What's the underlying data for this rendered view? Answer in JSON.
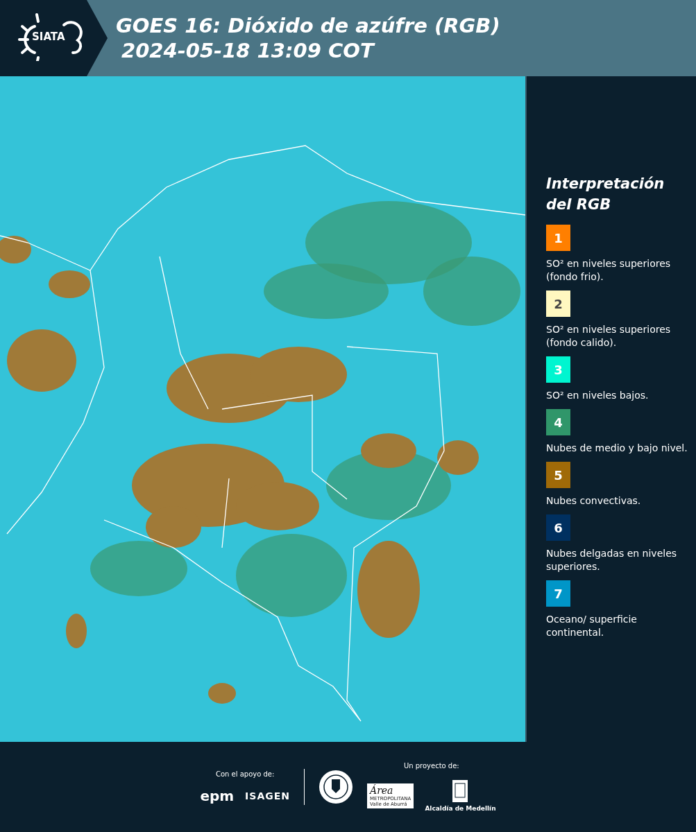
{
  "header": {
    "logo_text": "SIATA",
    "title_lines": [
      "GOES 16: Dióxido de azúfre (RGB)",
      "2024-05-18 13:09 COT"
    ]
  },
  "legend": {
    "title": "Interpretación del RGB",
    "items": [
      {
        "number": "1",
        "color": "#ff7f00",
        "text": "SO² en niveles superiores (fondo frio)."
      },
      {
        "number": "2",
        "color": "#fff8c0",
        "text": "SO² en niveles superiores (fondo calido)."
      },
      {
        "number": "3",
        "color": "#00f5d0",
        "text": "SO² en niveles bajos."
      },
      {
        "number": "4",
        "color": "#30966a",
        "text": "Nubes de medio y bajo nivel."
      },
      {
        "number": "5",
        "color": "#a06a08",
        "text": "Nubes convectivas."
      },
      {
        "number": "6",
        "color": "#003060",
        "text": "Nubes delgadas en niveles superiores."
      },
      {
        "number": "7",
        "color": "#0096c8",
        "text": "Oceano/ superficie continental."
      }
    ]
  },
  "footer": {
    "support_label": "Con el apoyo de:",
    "support_logos": [
      "epm",
      "ISAGEN"
    ],
    "project_label": "Un proyecto de:",
    "area_logo": {
      "name": "Área",
      "lines": [
        "METROPOLITANA",
        "Valle de Aburrá"
      ]
    },
    "alcaldia_label": "Alcaldía de Medellín"
  }
}
